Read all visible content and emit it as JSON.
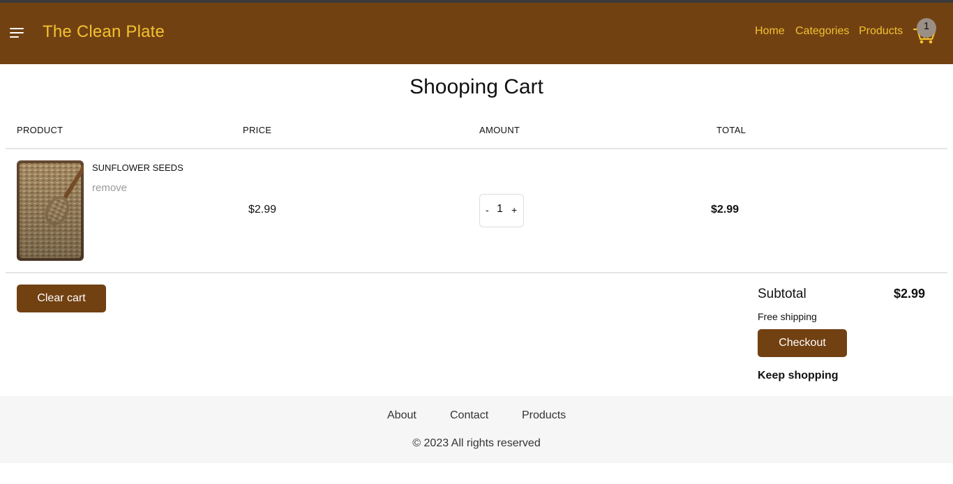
{
  "header": {
    "brand": "The Clean Plate",
    "nav": [
      {
        "label": "Home",
        "icon": ""
      },
      {
        "label": "Categories",
        "icon": ""
      },
      {
        "label": "Products",
        "icon": ""
      }
    ],
    "cart_count": "1",
    "menu_icon": "hamburger-icon",
    "cart_icon": "shopping-cart-icon"
  },
  "page": {
    "title": "Shooping Cart"
  },
  "table": {
    "headers": [
      "PRODUCT",
      "PRICE",
      "AMOUNT",
      "TOTAL"
    ],
    "rows": [
      {
        "name": "SUNFLOWER SEEDS",
        "remove_label": "remove",
        "price": "$2.99",
        "qty_minus": "-",
        "qty": "1",
        "qty_plus": "+",
        "total": "$2.99",
        "image": "sunflower-seeds-photo"
      }
    ]
  },
  "actions": {
    "clear_cart": "Clear cart",
    "checkout": "Checkout",
    "keep_shopping": "Keep shopping"
  },
  "summary": {
    "subtotal_label": "Subtotal",
    "subtotal_value": "$2.99",
    "shipping": "Free shipping"
  },
  "footer": {
    "links": [
      "About",
      "Contact",
      "Products"
    ],
    "copyright": "© 2023 All rights reserved"
  },
  "colors": {
    "brand_bg": "#724112",
    "brand_accent": "#f2c230",
    "footer_bg": "#f6f6f6"
  }
}
